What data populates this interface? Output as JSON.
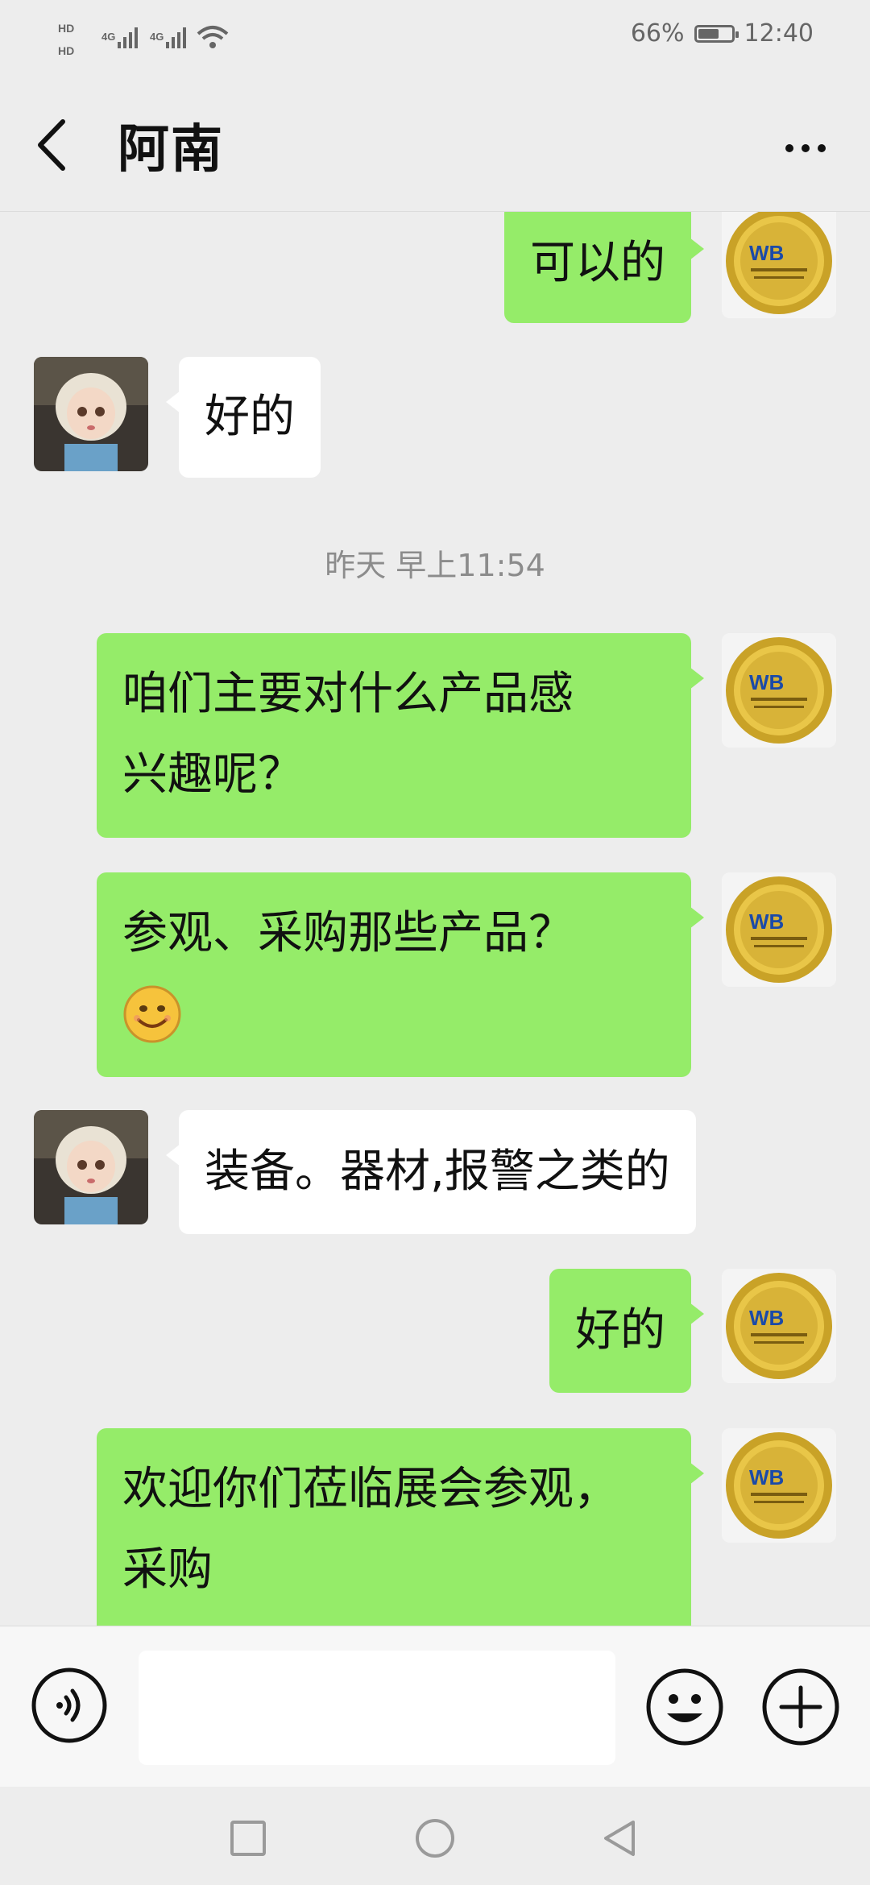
{
  "status_bar": {
    "network_left": "HD 4G 4G",
    "battery_percent": "66%",
    "battery_level": 0.66,
    "time": "12:40"
  },
  "header": {
    "back_icon": "chevron-left-icon",
    "title": "阿南",
    "more_icon": "more-dots-icon"
  },
  "chat": {
    "messages": [
      {
        "side": "out",
        "text": "可以的"
      },
      {
        "side": "in",
        "text": "好的"
      },
      {
        "type": "time",
        "text": "昨天 早上11:54"
      },
      {
        "side": "out",
        "lines": [
          "咱们主要对什么产品感",
          "兴趣呢？"
        ]
      },
      {
        "side": "out",
        "lines": [
          "参观、采购那些产品？"
        ],
        "emoji": "smile-emoji"
      },
      {
        "side": "in",
        "text": "装备。器材,报警之类的"
      },
      {
        "side": "out",
        "text": "好的"
      },
      {
        "side": "out",
        "lines": [
          "欢迎你们莅临展会参观，",
          "采购"
        ]
      }
    ],
    "colors": {
      "out_bubble": "#95ec69",
      "in_bubble": "#ffffff",
      "background": "#ededed"
    }
  },
  "input_bar": {
    "voice_icon": "voice-icon",
    "emoji_icon": "emoji-icon",
    "plus_icon": "plus-icon",
    "text_value": ""
  },
  "nav_bar": {
    "icons": [
      "recents-square-icon",
      "home-circle-icon",
      "back-triangle-icon"
    ]
  }
}
